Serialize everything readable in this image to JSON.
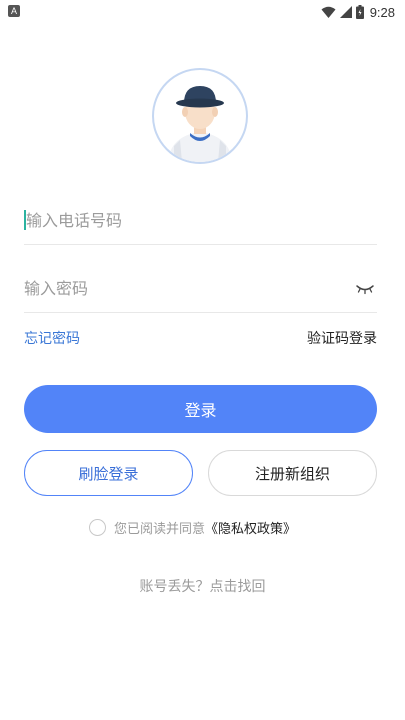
{
  "status_bar": {
    "app_glyph": "A",
    "time": "9:28",
    "icons": [
      "wifi-icon",
      "signal-icon",
      "battery-icon"
    ]
  },
  "avatar": {
    "icon": "avatar-icon"
  },
  "phone_field": {
    "placeholder": "输入电话号码",
    "value": ""
  },
  "password_field": {
    "placeholder": "输入密码",
    "value": "",
    "toggle_icon": "eye-closed-icon"
  },
  "links": {
    "forgot_password": "忘记密码",
    "sms_login": "验证码登录"
  },
  "buttons": {
    "login": "登录",
    "face_login": "刷脸登录",
    "register_org": "注册新组织"
  },
  "agreement": {
    "checked": false,
    "text": "您已阅读并同意",
    "policy": "《隐私权政策》"
  },
  "account_lost": "账号丢失？点击找回",
  "colors": {
    "primary": "#5284f8",
    "link": "#3a77d6",
    "caret": "#2bb3a0",
    "muted": "#9b9b9b"
  }
}
